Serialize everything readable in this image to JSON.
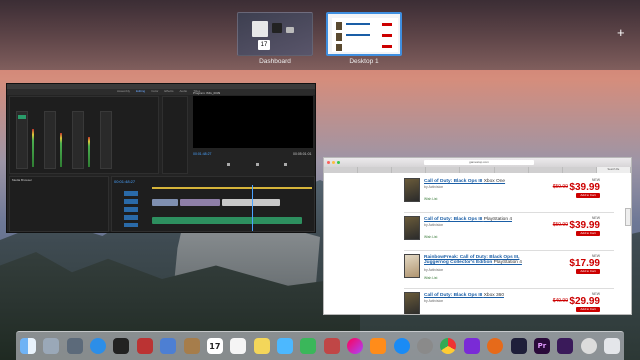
{
  "spaces": {
    "dashboard_label": "Dashboard",
    "desktop_label": "Desktop 1",
    "add_space_symbol": "+"
  },
  "browser": {
    "url": "gamestop.com",
    "tabs": [
      "",
      "",
      "",
      "",
      "",
      "",
      "",
      "",
      "Search Re"
    ],
    "items": [
      {
        "title": "Call of Duty: Black Ops III",
        "platform": "Xbox One",
        "publisher": "by Activision",
        "label_new": "NEW",
        "old_price": "$59.99",
        "price": "$39.99",
        "cart": "Add to Cart",
        "wishlist": "Wish List"
      },
      {
        "title": "Call of Duty: Black Ops III",
        "platform": "PlayStation 4",
        "publisher": "by Activision",
        "label_new": "NEW",
        "old_price": "$59.99",
        "price": "$39.99",
        "cart": "Add to Cart",
        "wishlist": "Wish List"
      },
      {
        "title": "RainbowFreak: Call of Duty: Black Ops III, Juggernog Collector's Edition",
        "platform": "PlayStation 4",
        "publisher": "by Activision",
        "label_new": "NEW",
        "old_price": "",
        "price": "$17.99",
        "cart": "Add to Cart",
        "wishlist": "Wish List"
      },
      {
        "title": "Call of Duty: Black Ops III",
        "platform": "Xbox 360",
        "publisher": "by Activision",
        "label_new": "NEW",
        "old_price": "$49.99",
        "price": "$29.99",
        "cart": "Add to Cart",
        "wishlist": "Wish List"
      }
    ]
  },
  "premiere": {
    "program_title": "Program: IMG_0039",
    "timecode_left": "00:01:48:27",
    "timecode_right": "00:05:01:01",
    "sequence_timecode": "00:01:48:27",
    "media_browser": "Media Browser",
    "tabs": [
      "Assembly",
      "Editing",
      "Color",
      "Effects",
      "Audio",
      "Titles"
    ]
  },
  "dock": {
    "calendar_day": "17",
    "icons": [
      "finder-icon",
      "launchpad-icon",
      "rocket-icon",
      "safari-icon",
      "terminal-icon",
      "photobooth-icon",
      "app-store-icon",
      "contacts-icon",
      "calendar-icon",
      "reminders-icon",
      "notes-icon",
      "messages-icon",
      "facetime-icon",
      "photos-icon",
      "itunes-icon",
      "ibooks-icon",
      "app-store2-icon",
      "preferences-icon",
      "chrome-icon",
      "imovie-icon",
      "firefox-icon",
      "ae-icon",
      "premiere-icon",
      "media-encoder-icon",
      "downloads-icon",
      "trash-icon"
    ]
  }
}
